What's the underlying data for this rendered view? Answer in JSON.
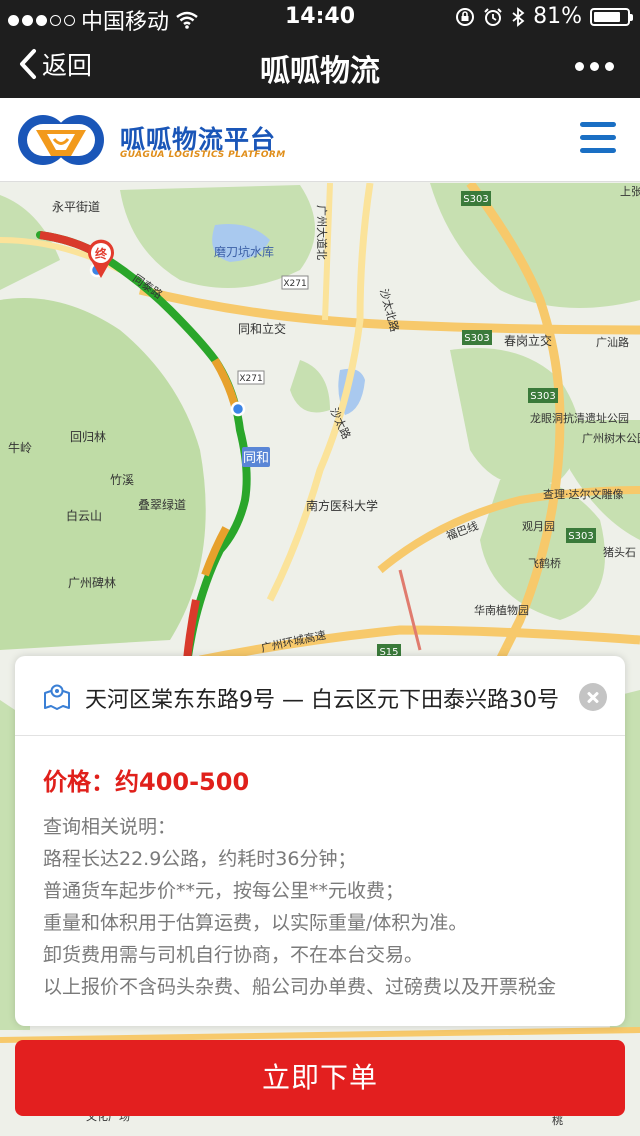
{
  "status_bar": {
    "carrier": "中国移动",
    "time": "14:40",
    "battery": "81%",
    "battery_level": 0.81
  },
  "nav": {
    "back_label": "返回",
    "title": "呱呱物流"
  },
  "brand": {
    "name": "呱呱物流平台",
    "subtitle": "GUAGUA LOGISTICS PLATFORM"
  },
  "map": {
    "labels": [
      {
        "text": "永平街道"
      },
      {
        "text": "磨刀坑水库"
      },
      {
        "text": "同和立交"
      },
      {
        "text": "春岗立交"
      },
      {
        "text": "广州大道北"
      },
      {
        "text": "沙太北路"
      },
      {
        "text": "沙太路"
      },
      {
        "text": "同泰路"
      },
      {
        "text": "回归林"
      },
      {
        "text": "牛岭"
      },
      {
        "text": "竹溪"
      },
      {
        "text": "叠翠绿道"
      },
      {
        "text": "白云山"
      },
      {
        "text": "广州碑林"
      },
      {
        "text": "南方医科大学"
      },
      {
        "text": "同和"
      },
      {
        "text": "龙眼洞抗清遗址公园"
      },
      {
        "text": "查理·达尔文雕像"
      },
      {
        "text": "观月园"
      },
      {
        "text": "飞鹤桥"
      },
      {
        "text": "猪头石"
      },
      {
        "text": "华南植物园"
      },
      {
        "text": "广州环城高速"
      },
      {
        "text": "广汕路"
      },
      {
        "text": "上张"
      },
      {
        "text": "广州树木公园"
      },
      {
        "text": "文化广场"
      },
      {
        "text": "福巴线"
      },
      {
        "text": "桃"
      }
    ],
    "badges": [
      "S303",
      "S303",
      "S303",
      "S303",
      "X271",
      "X271",
      "S15"
    ],
    "end_marker": "终"
  },
  "card": {
    "route": "天河区棠东东路9号 — 白云区元下田泰兴路30号",
    "price": "价格：约400-500",
    "notes": [
      "查询相关说明：",
      "路程长达22.9公路，约耗时36分钟；",
      "普通货车起步价**元，按每公里**元收费；",
      "重量和体积用于估算运费，以实际重量/体积为准。",
      "卸货费用需与司机自行协商，不在本台交易。",
      "以上报价不含码头杂费、船公司办单费、过磅费以及开票税金"
    ]
  },
  "order_button": "立即下单",
  "colors": {
    "price": "#e0201b",
    "button": "#e31f1f",
    "brand_blue": "#1a56b8",
    "brand_orange": "#e08e1a",
    "route_green": "#2aa62a",
    "route_red": "#d93a2b"
  },
  "icons": {
    "back": "chevron-left-icon",
    "more": "more-dots-icon",
    "menu": "hamburger-menu-icon",
    "route": "map-route-icon",
    "close": "close-circle-icon",
    "end_marker": "map-pin-icon",
    "start": "location-dot-icon"
  }
}
